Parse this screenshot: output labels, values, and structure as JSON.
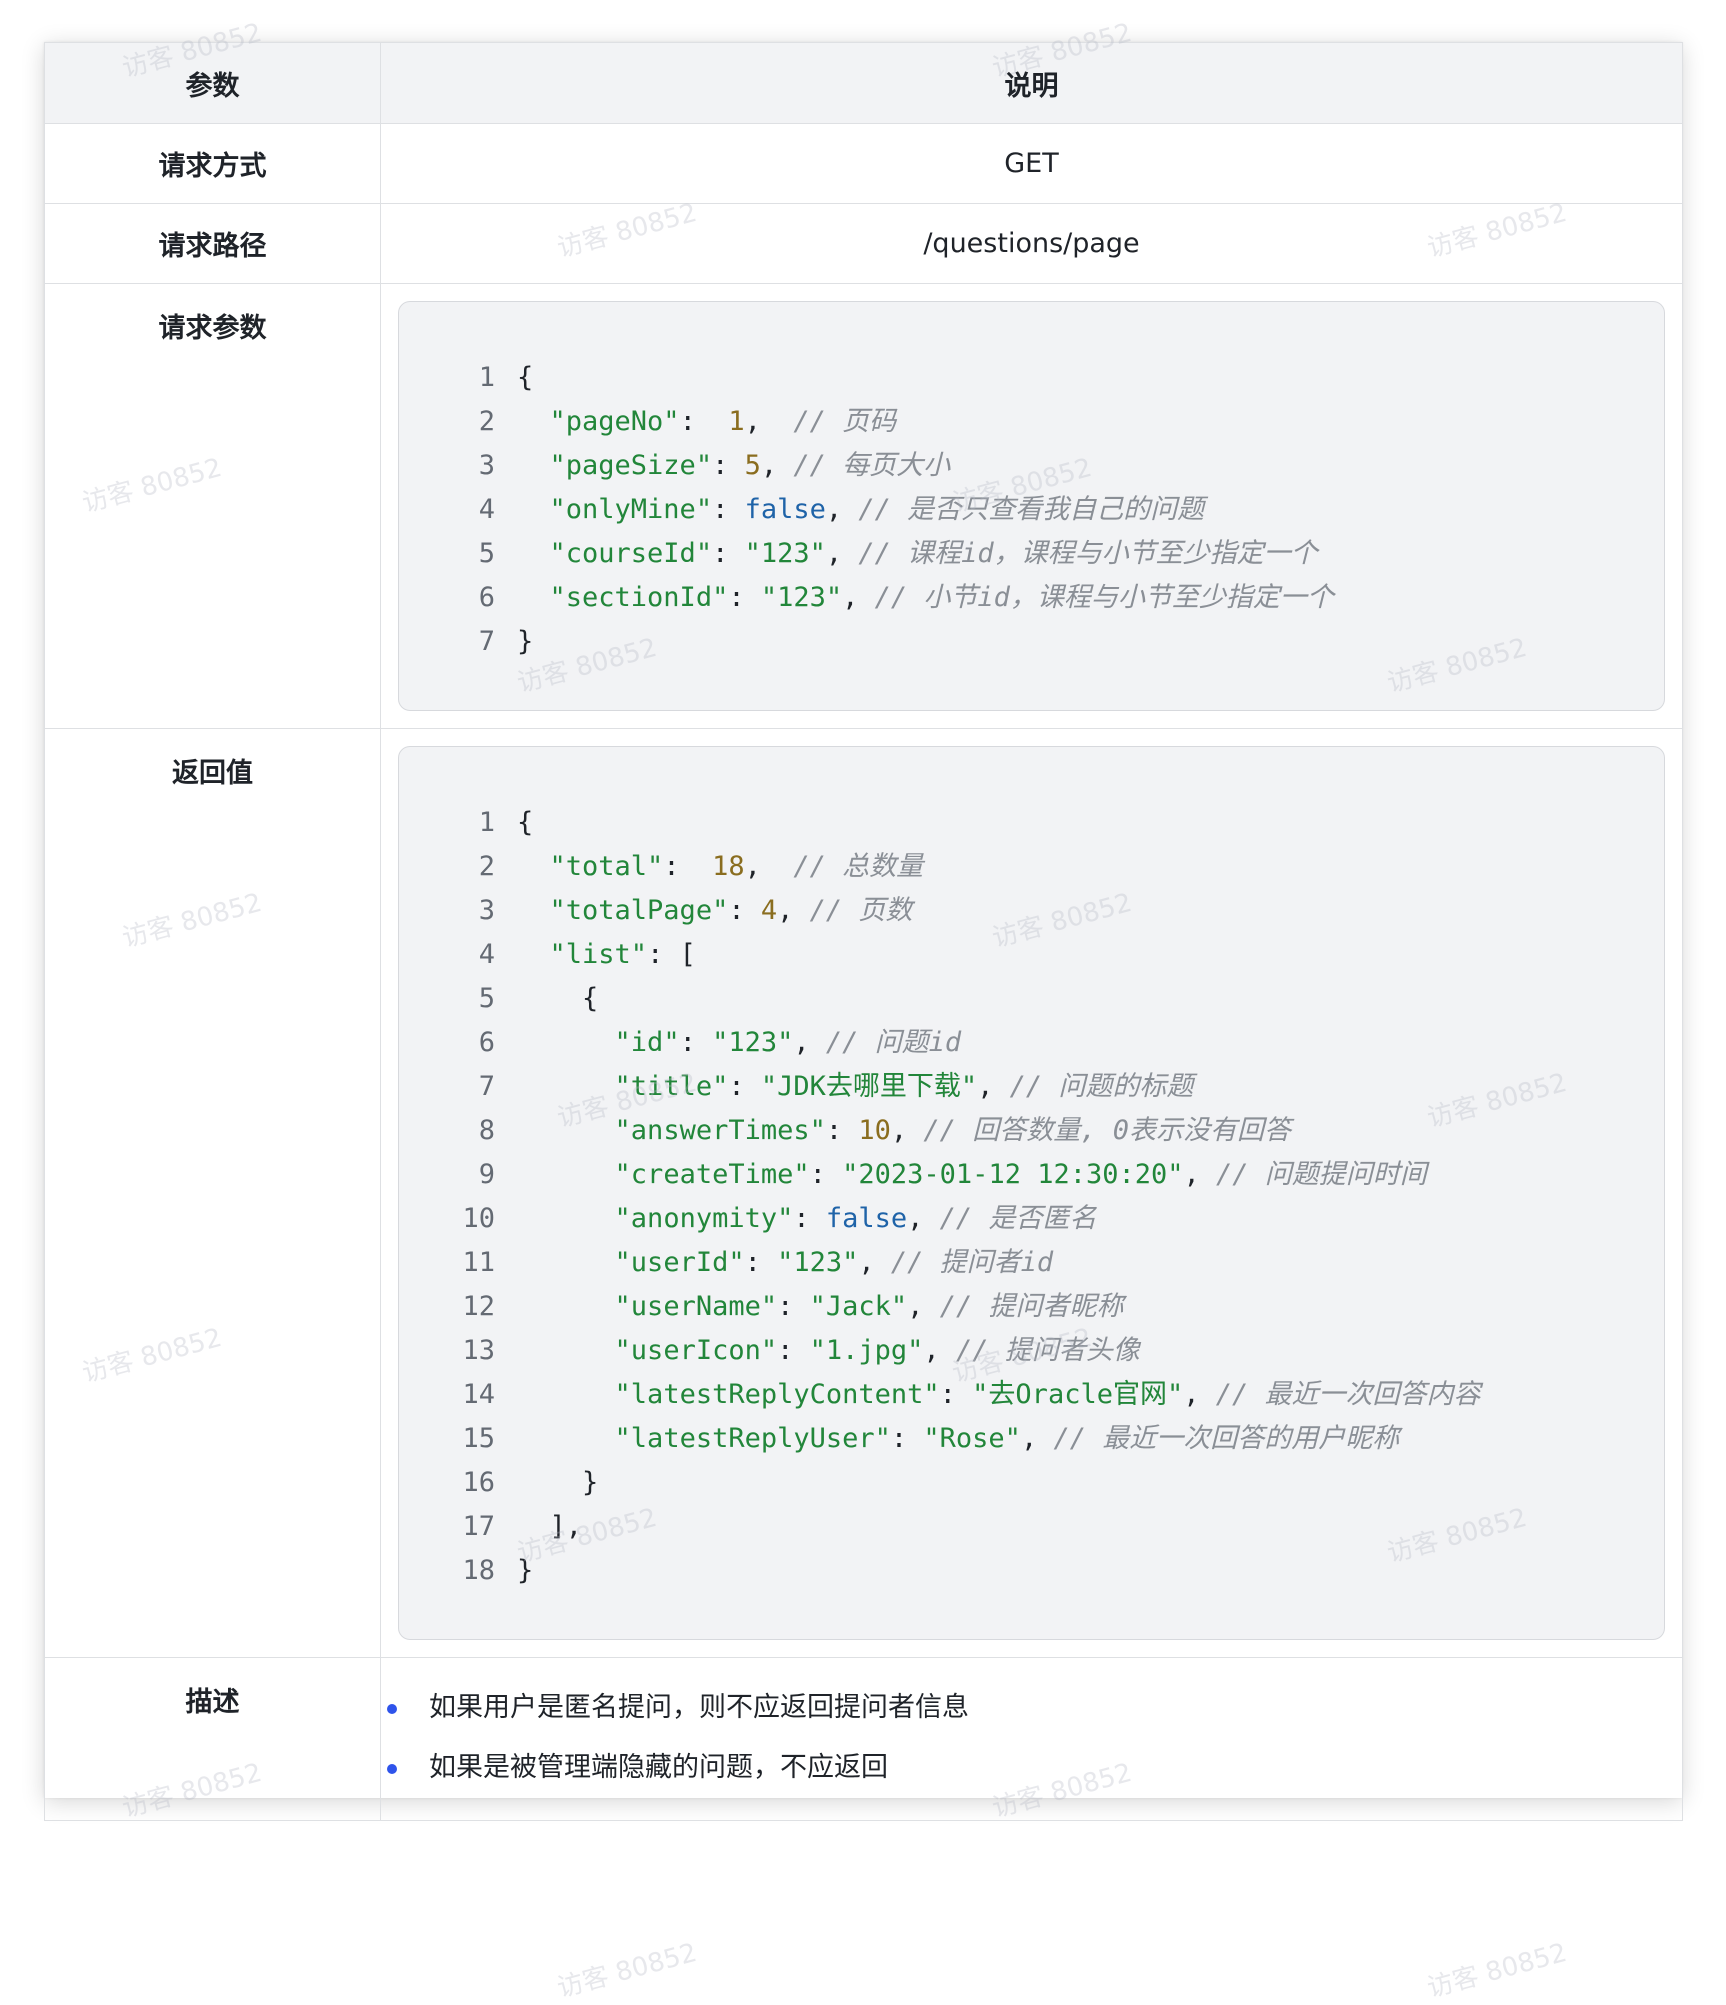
{
  "table": {
    "header": {
      "param": "参数",
      "desc": "说明"
    },
    "method": {
      "label": "请求方式",
      "value": "GET"
    },
    "path": {
      "label": "请求路径",
      "value": "/questions/page"
    },
    "params_label": "请求参数",
    "return_label": "返回值",
    "describe_label": "描述",
    "describe_items": [
      "如果用户是匿名提问，则不应返回提问者信息",
      "如果是被管理端隐藏的问题，不应返回"
    ]
  },
  "request_code": [
    {
      "n": "1",
      "t": [
        {
          "c": "p",
          "v": "{"
        }
      ]
    },
    {
      "n": "2",
      "t": [
        {
          "c": "p",
          "v": "  "
        },
        {
          "c": "k",
          "v": "\"pageNo\""
        },
        {
          "c": "p",
          "v": ":  "
        },
        {
          "c": "n",
          "v": "1"
        },
        {
          "c": "p",
          "v": ",  "
        },
        {
          "c": "c",
          "v": "// 页码"
        }
      ]
    },
    {
      "n": "3",
      "t": [
        {
          "c": "p",
          "v": "  "
        },
        {
          "c": "k",
          "v": "\"pageSize\""
        },
        {
          "c": "p",
          "v": ": "
        },
        {
          "c": "n",
          "v": "5"
        },
        {
          "c": "p",
          "v": ", "
        },
        {
          "c": "c",
          "v": "// 每页大小"
        }
      ]
    },
    {
      "n": "4",
      "t": [
        {
          "c": "p",
          "v": "  "
        },
        {
          "c": "k",
          "v": "\"onlyMine\""
        },
        {
          "c": "p",
          "v": ": "
        },
        {
          "c": "b",
          "v": "false"
        },
        {
          "c": "p",
          "v": ", "
        },
        {
          "c": "c",
          "v": "// 是否只查看我自己的问题"
        }
      ]
    },
    {
      "n": "5",
      "t": [
        {
          "c": "p",
          "v": "  "
        },
        {
          "c": "k",
          "v": "\"courseId\""
        },
        {
          "c": "p",
          "v": ": "
        },
        {
          "c": "s",
          "v": "\"123\""
        },
        {
          "c": "p",
          "v": ", "
        },
        {
          "c": "c",
          "v": "// 课程id，课程与小节至少指定一个"
        }
      ]
    },
    {
      "n": "6",
      "t": [
        {
          "c": "p",
          "v": "  "
        },
        {
          "c": "k",
          "v": "\"sectionId\""
        },
        {
          "c": "p",
          "v": ": "
        },
        {
          "c": "s",
          "v": "\"123\""
        },
        {
          "c": "p",
          "v": ", "
        },
        {
          "c": "c",
          "v": "// 小节id，课程与小节至少指定一个"
        }
      ]
    },
    {
      "n": "7",
      "t": [
        {
          "c": "p",
          "v": "}"
        }
      ]
    }
  ],
  "return_code": [
    {
      "n": "1",
      "t": [
        {
          "c": "p",
          "v": "{"
        }
      ]
    },
    {
      "n": "2",
      "t": [
        {
          "c": "p",
          "v": "  "
        },
        {
          "c": "k",
          "v": "\"total\""
        },
        {
          "c": "p",
          "v": ":  "
        },
        {
          "c": "n",
          "v": "18"
        },
        {
          "c": "p",
          "v": ",  "
        },
        {
          "c": "c",
          "v": "// 总数量"
        }
      ]
    },
    {
      "n": "3",
      "t": [
        {
          "c": "p",
          "v": "  "
        },
        {
          "c": "k",
          "v": "\"totalPage\""
        },
        {
          "c": "p",
          "v": ": "
        },
        {
          "c": "n",
          "v": "4"
        },
        {
          "c": "p",
          "v": ", "
        },
        {
          "c": "c",
          "v": "// 页数"
        }
      ]
    },
    {
      "n": "4",
      "t": [
        {
          "c": "p",
          "v": "  "
        },
        {
          "c": "k",
          "v": "\"list\""
        },
        {
          "c": "p",
          "v": ": ["
        }
      ]
    },
    {
      "n": "5",
      "t": [
        {
          "c": "p",
          "v": "    {"
        }
      ]
    },
    {
      "n": "6",
      "t": [
        {
          "c": "p",
          "v": "      "
        },
        {
          "c": "k",
          "v": "\"id\""
        },
        {
          "c": "p",
          "v": ": "
        },
        {
          "c": "s",
          "v": "\"123\""
        },
        {
          "c": "p",
          "v": ", "
        },
        {
          "c": "c",
          "v": "// 问题id"
        }
      ]
    },
    {
      "n": "7",
      "t": [
        {
          "c": "p",
          "v": "      "
        },
        {
          "c": "k",
          "v": "\"title\""
        },
        {
          "c": "p",
          "v": ": "
        },
        {
          "c": "s",
          "v": "\"JDK去哪里下载\""
        },
        {
          "c": "p",
          "v": ", "
        },
        {
          "c": "c",
          "v": "// 问题的标题"
        }
      ]
    },
    {
      "n": "8",
      "t": [
        {
          "c": "p",
          "v": "      "
        },
        {
          "c": "k",
          "v": "\"answerTimes\""
        },
        {
          "c": "p",
          "v": ": "
        },
        {
          "c": "n",
          "v": "10"
        },
        {
          "c": "p",
          "v": ", "
        },
        {
          "c": "c",
          "v": "// 回答数量, 0表示没有回答"
        }
      ]
    },
    {
      "n": "9",
      "t": [
        {
          "c": "p",
          "v": "      "
        },
        {
          "c": "k",
          "v": "\"createTime\""
        },
        {
          "c": "p",
          "v": ": "
        },
        {
          "c": "s",
          "v": "\"2023-01-12 12:30:20\""
        },
        {
          "c": "p",
          "v": ", "
        },
        {
          "c": "c",
          "v": "// 问题提问时间"
        }
      ]
    },
    {
      "n": "10",
      "t": [
        {
          "c": "p",
          "v": "      "
        },
        {
          "c": "k",
          "v": "\"anonymity\""
        },
        {
          "c": "p",
          "v": ": "
        },
        {
          "c": "b",
          "v": "false"
        },
        {
          "c": "p",
          "v": ", "
        },
        {
          "c": "c",
          "v": "// 是否匿名"
        }
      ]
    },
    {
      "n": "11",
      "t": [
        {
          "c": "p",
          "v": "      "
        },
        {
          "c": "k",
          "v": "\"userId\""
        },
        {
          "c": "p",
          "v": ": "
        },
        {
          "c": "s",
          "v": "\"123\""
        },
        {
          "c": "p",
          "v": ", "
        },
        {
          "c": "c",
          "v": "// 提问者id"
        }
      ]
    },
    {
      "n": "12",
      "t": [
        {
          "c": "p",
          "v": "      "
        },
        {
          "c": "k",
          "v": "\"userName\""
        },
        {
          "c": "p",
          "v": ": "
        },
        {
          "c": "s",
          "v": "\"Jack\""
        },
        {
          "c": "p",
          "v": ", "
        },
        {
          "c": "c",
          "v": "// 提问者昵称"
        }
      ]
    },
    {
      "n": "13",
      "t": [
        {
          "c": "p",
          "v": "      "
        },
        {
          "c": "k",
          "v": "\"userIcon\""
        },
        {
          "c": "p",
          "v": ": "
        },
        {
          "c": "s",
          "v": "\"1.jpg\""
        },
        {
          "c": "p",
          "v": ", "
        },
        {
          "c": "c",
          "v": "// 提问者头像"
        }
      ]
    },
    {
      "n": "14",
      "t": [
        {
          "c": "p",
          "v": "      "
        },
        {
          "c": "k",
          "v": "\"latestReplyContent\""
        },
        {
          "c": "p",
          "v": ": "
        },
        {
          "c": "s",
          "v": "\"去Oracle官网\""
        },
        {
          "c": "p",
          "v": ", "
        },
        {
          "c": "c",
          "v": "// 最近一次回答内容"
        }
      ]
    },
    {
      "n": "15",
      "t": [
        {
          "c": "p",
          "v": "      "
        },
        {
          "c": "k",
          "v": "\"latestReplyUser\""
        },
        {
          "c": "p",
          "v": ": "
        },
        {
          "c": "s",
          "v": "\"Rose\""
        },
        {
          "c": "p",
          "v": ", "
        },
        {
          "c": "c",
          "v": "// 最近一次回答的用户昵称"
        }
      ]
    },
    {
      "n": "16",
      "t": [
        {
          "c": "p",
          "v": "    }"
        }
      ]
    },
    {
      "n": "17",
      "t": [
        {
          "c": "p",
          "v": "  ],"
        }
      ]
    },
    {
      "n": "18",
      "t": [
        {
          "c": "p",
          "v": "}"
        }
      ]
    }
  ],
  "watermark": "访客 80852",
  "colors": {
    "key": "#22863a",
    "number": "#8a6d1f",
    "bool": "#1f63a8",
    "comment": "#8a8f96",
    "bullet": "#2f54eb"
  }
}
